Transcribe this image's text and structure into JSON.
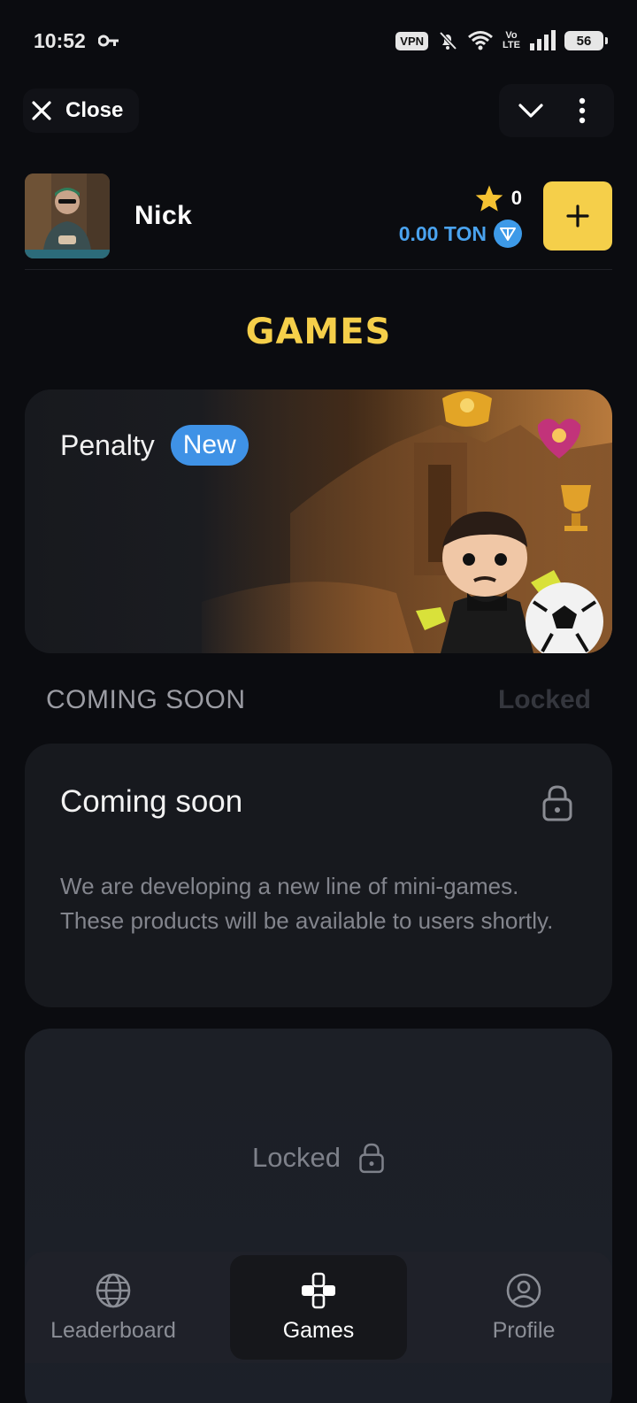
{
  "status_bar": {
    "time": "10:52",
    "vpn": "VPN",
    "volte_top": "Vo",
    "volte_bottom": "LTE",
    "battery": "56"
  },
  "top_bar": {
    "close_label": "Close"
  },
  "user": {
    "name": "Nick",
    "stars": "0",
    "ton_balance": "0.00 TON"
  },
  "page": {
    "title": "GAMES"
  },
  "featured_game": {
    "name": "Penalty",
    "badge": "New"
  },
  "coming_section": {
    "title": "COMING SOON",
    "status": "Locked"
  },
  "coming_card": {
    "title": "Coming soon",
    "description": "We are developing a new line of mini-games. These products will be available to users shortly."
  },
  "locked_card": {
    "label": "Locked"
  },
  "nav": {
    "items": [
      {
        "label": "Leaderboard",
        "icon": "globe-icon"
      },
      {
        "label": "Games",
        "icon": "gamepad-icon"
      },
      {
        "label": "Profile",
        "icon": "user-circle-icon"
      }
    ],
    "active": "Games"
  },
  "colors": {
    "accent": "#f5cf4a",
    "ton_blue": "#3f92e6",
    "background": "#0b0c10"
  }
}
